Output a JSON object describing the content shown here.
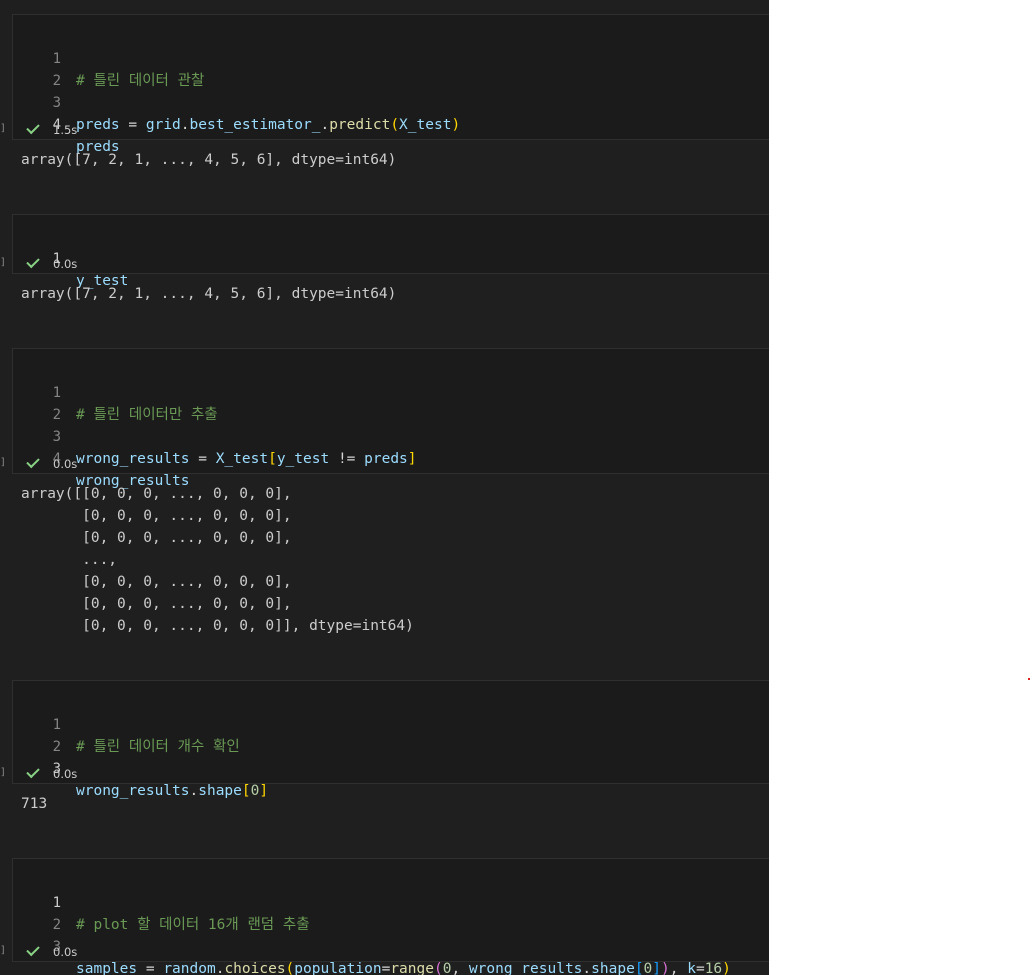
{
  "cells": [
    {
      "lines": [
        "1",
        "2",
        "3",
        "4"
      ],
      "code": {
        "c1_comment": "# 틀린 데이터 관찰",
        "c1_l3_a": "preds",
        "c1_l3_eq": " = ",
        "c1_l3_b": "grid",
        "c1_l3_dot1": ".",
        "c1_l3_c": "best_estimator_",
        "c1_l3_dot2": ".",
        "c1_l3_fn": "predict",
        "c1_l3_open": "(",
        "c1_l3_arg": "X_test",
        "c1_l3_close": ")",
        "c1_l4": "preds"
      },
      "status": "1.5s",
      "output": "array([7, 2, 1, ..., 4, 5, 6], dtype=int64)"
    },
    {
      "lines": [
        "1"
      ],
      "code": {
        "c2_l1": "y_test"
      },
      "status": "0.0s",
      "output": "array([7, 2, 1, ..., 4, 5, 6], dtype=int64)"
    },
    {
      "lines": [
        "1",
        "2",
        "3",
        "4"
      ],
      "code": {
        "c3_comment": "# 틀린 데이터만 추출",
        "c3_l3_a": "wrong_results",
        "c3_l3_eq": " = ",
        "c3_l3_b": "X_test",
        "c3_l3_open": "[",
        "c3_l3_c": "y_test",
        "c3_l3_ne": " != ",
        "c3_l3_d": "preds",
        "c3_l3_close": "]",
        "c3_l4": "wrong_results"
      },
      "status": "0.0s",
      "output": [
        "array([[0, 0, 0, ..., 0, 0, 0],",
        "       [0, 0, 0, ..., 0, 0, 0],",
        "       [0, 0, 0, ..., 0, 0, 0],",
        "       ...,",
        "       [0, 0, 0, ..., 0, 0, 0],",
        "       [0, 0, 0, ..., 0, 0, 0],",
        "       [0, 0, 0, ..., 0, 0, 0]], dtype=int64)"
      ]
    },
    {
      "lines": [
        "1",
        "2",
        "3"
      ],
      "code": {
        "c4_comment": "# 틀린 데이터 개수 확인",
        "c4_l3_a": "wrong_results",
        "c4_l3_dot": ".",
        "c4_l3_b": "shape",
        "c4_l3_open": "[",
        "c4_l3_num": "0",
        "c4_l3_close": "]"
      },
      "status": "0.0s",
      "output": "713"
    },
    {
      "lines": [
        "1",
        "2",
        "3"
      ],
      "code": {
        "c5_comment": "# plot 할 데이터 16개 랜덤 추출",
        "c5_a": "samples",
        "c5_eq": " = ",
        "c5_b": "random",
        "c5_dot1": ".",
        "c5_fn": "choices",
        "c5_p1": "(",
        "c5_kw1": "population",
        "c5_eq2": "=",
        "c5_fn2": "range",
        "c5_p2": "(",
        "c5_n0": "0",
        "c5_comma": ", ",
        "c5_c": "wrong_results",
        "c5_dot2": ".",
        "c5_d": "shape",
        "c5_sq1": "[",
        "c5_n1": "0",
        "c5_sq2": "]",
        "c5_p3": ")",
        "c5_comma2": ", ",
        "c5_kw2": "k",
        "c5_eq3": "=",
        "c5_n16": "16",
        "c5_p4": ")"
      },
      "status": "0.0s"
    }
  ],
  "edge_marker": "]"
}
